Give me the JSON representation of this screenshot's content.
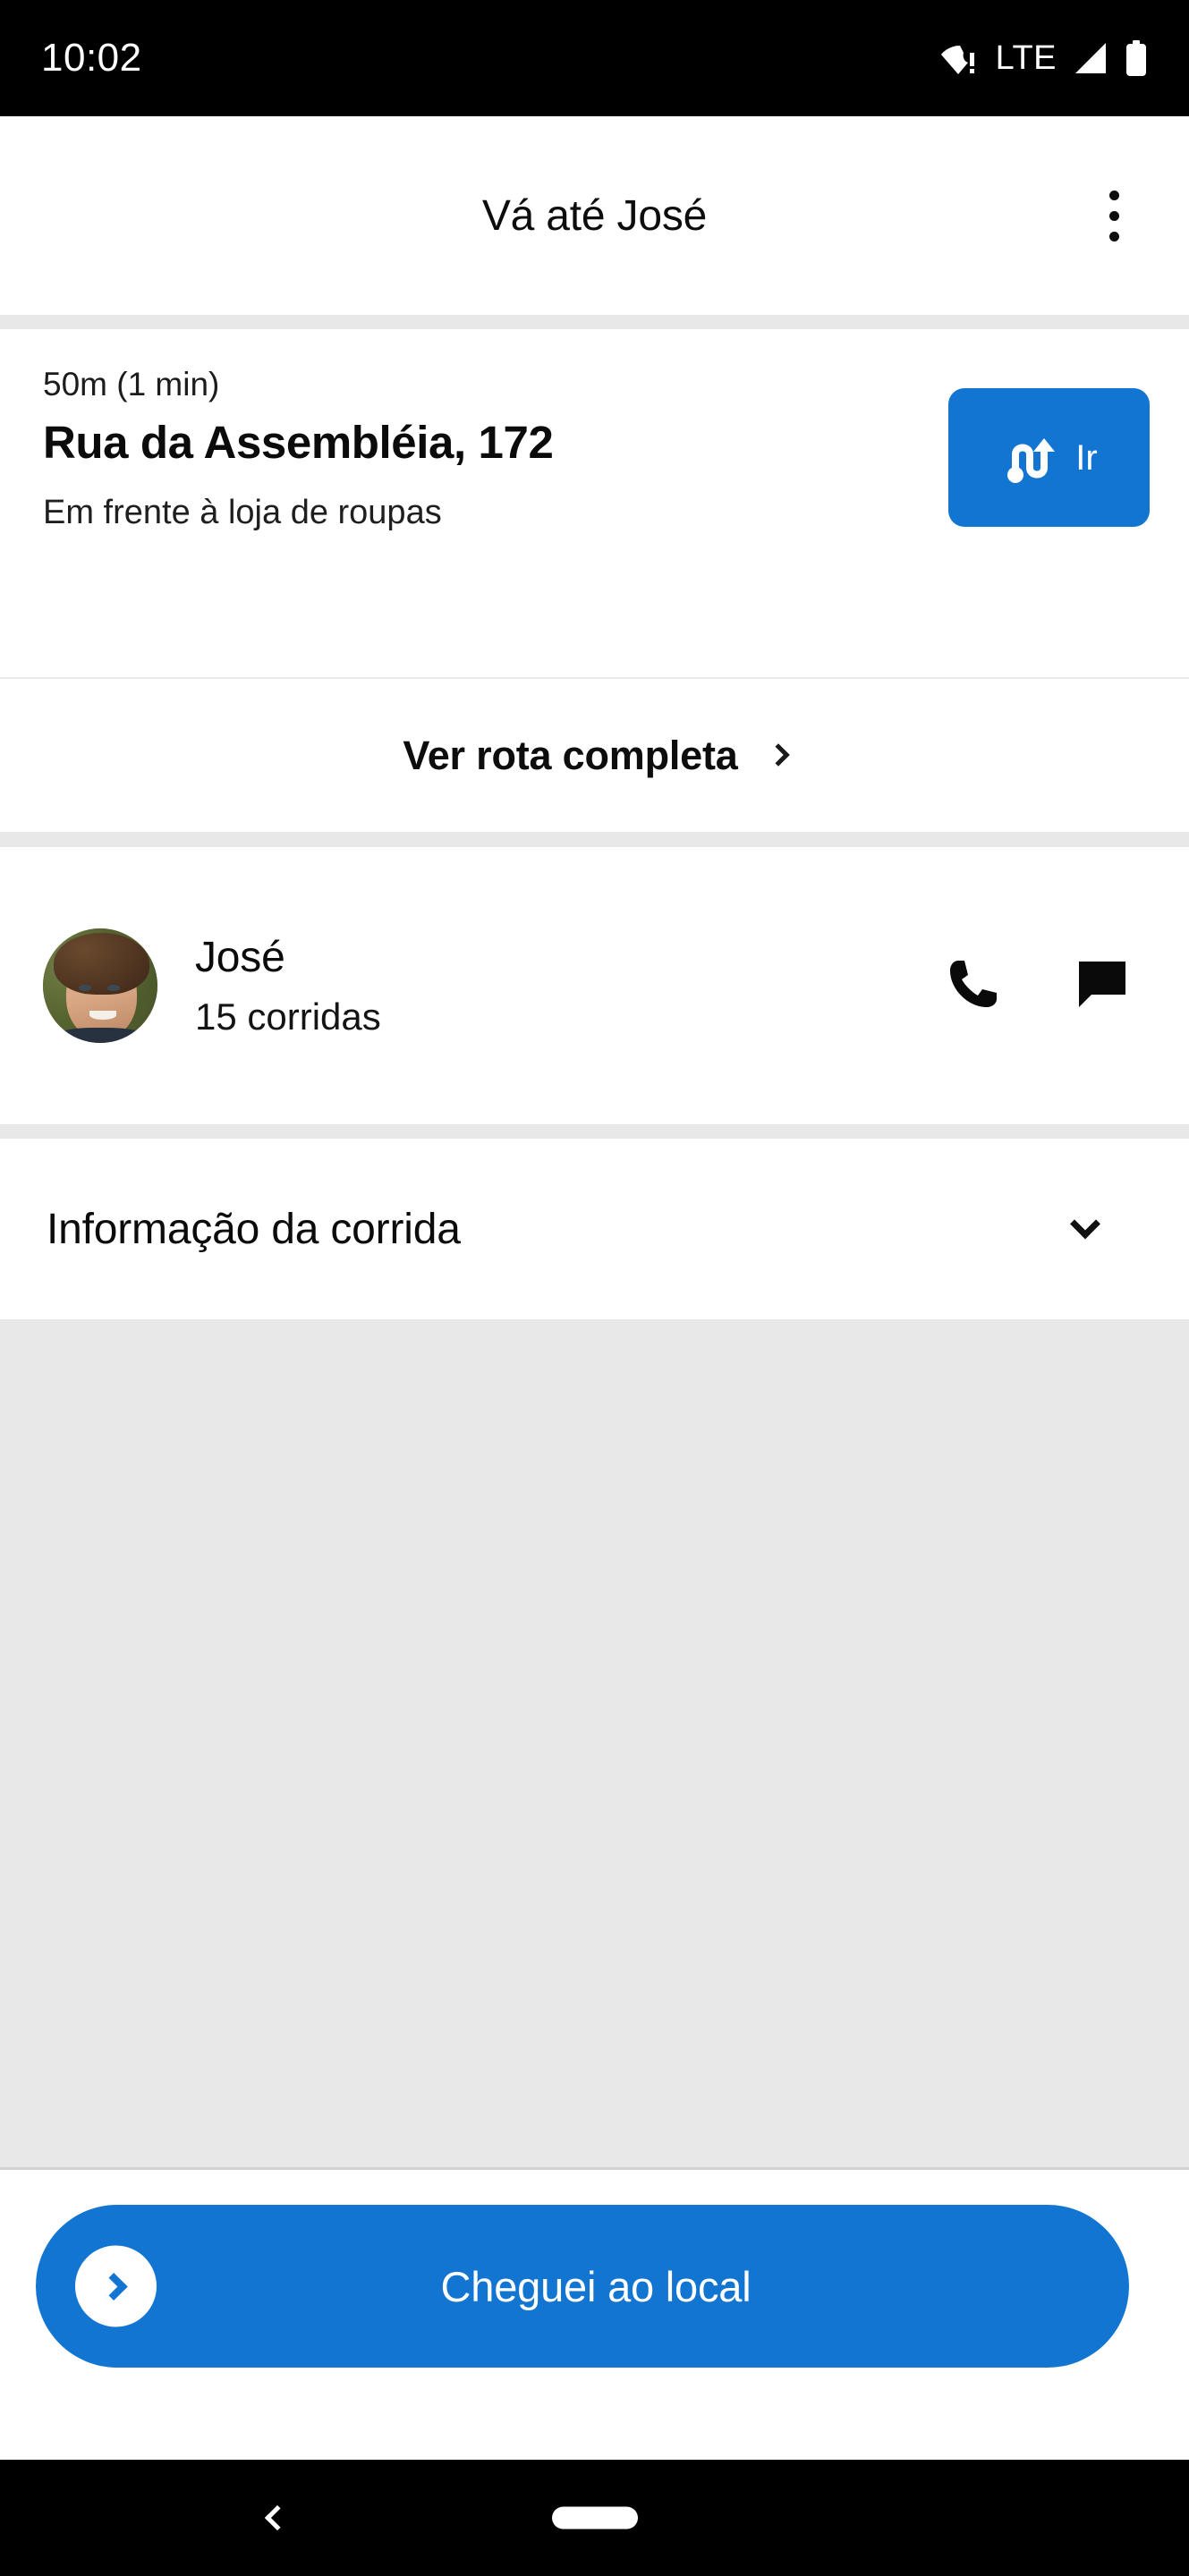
{
  "status_bar": {
    "time": "10:02",
    "network_label": "LTE",
    "icons": [
      "wifi-warning-icon",
      "signal-icon",
      "battery-icon"
    ]
  },
  "app_bar": {
    "title": "Vá até José",
    "overflow_icon": "more-vertical-icon"
  },
  "destination": {
    "eta": "50m (1 min)",
    "address": "Rua da Assembléia, 172",
    "note": "Em frente à loja de roupas",
    "go_button": {
      "label": "Ir",
      "icon": "route-icon",
      "color": "#1275d1"
    }
  },
  "full_route": {
    "label": "Ver rota completa",
    "chevron_icon": "chevron-right-icon"
  },
  "person": {
    "name": "José",
    "rides": "15 corridas",
    "avatar_icon": "user-photo-avatar",
    "call_icon": "phone-icon",
    "message_icon": "chat-bubble-icon"
  },
  "ride_info": {
    "title": "Informação da corrida",
    "expanded": false,
    "chevron_icon": "chevron-down-icon"
  },
  "primary_action": {
    "label": "Cheguei ao local",
    "thumb_icon": "chevron-right-icon",
    "color": "#1275d1"
  },
  "nav_bar": {
    "back_icon": "back-chevron-icon",
    "home_icon": "home-pill-icon"
  },
  "colors": {
    "accent": "#1275d1",
    "divider": "#e8e8e8",
    "panel": "#e8e8e8",
    "text_primary": "#0b0b0b",
    "system_bar": "#000000"
  }
}
